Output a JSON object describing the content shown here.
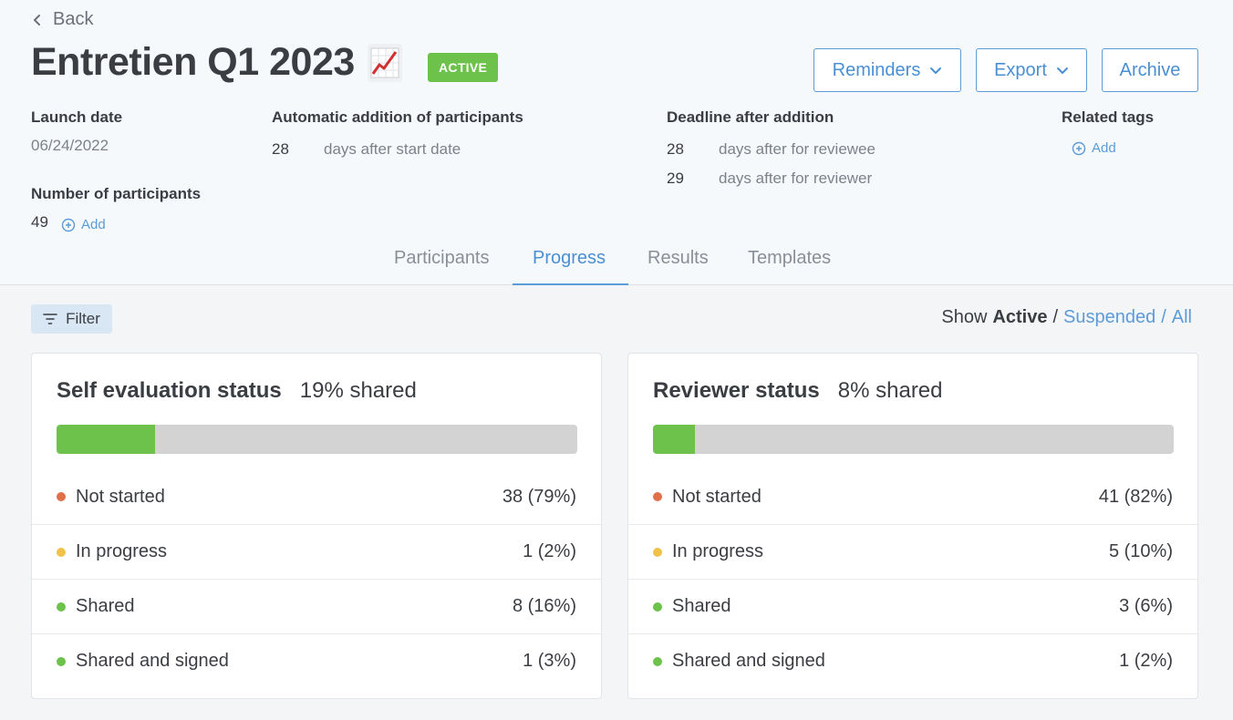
{
  "nav": {
    "back_label": "Back"
  },
  "campaign": {
    "title": "Entretien Q1 2023",
    "title_icon": "chart-increasing-icon",
    "status_badge": "ACTIVE"
  },
  "actions": {
    "reminders": "Reminders",
    "export": "Export",
    "archive": "Archive"
  },
  "meta": {
    "launch_date_label": "Launch date",
    "launch_date": "06/24/2022",
    "participants_label": "Number of participants",
    "participants_count": "49",
    "add_label": "Add",
    "auto_addition_label": "Automatic addition of participants",
    "auto_addition_days": "28",
    "auto_addition_text": "days after start date",
    "deadline_label": "Deadline after addition",
    "deadline_reviewee_days": "28",
    "deadline_reviewee_text": "days after for reviewee",
    "deadline_reviewer_days": "29",
    "deadline_reviewer_text": "days after for reviewer",
    "tags_label": "Related tags"
  },
  "tabs": [
    {
      "label": "Participants",
      "active": false
    },
    {
      "label": "Progress",
      "active": true
    },
    {
      "label": "Results",
      "active": false
    },
    {
      "label": "Templates",
      "active": false
    }
  ],
  "toolbar": {
    "filter_label": "Filter",
    "show_label": "Show",
    "show_active": "Active",
    "show_suspended": "Suspended",
    "show_all": "All",
    "separator": "/"
  },
  "colors": {
    "accent": "#5b9bd8",
    "success": "#6cc24a",
    "not_started": "#e0704a",
    "in_progress": "#f0c24a",
    "shared": "#6cc24a"
  },
  "cards": [
    {
      "title": "Self evaluation status",
      "shared_text": "19% shared",
      "progress": 0.19,
      "rows": [
        {
          "label": "Not started",
          "value": "38 (79%)",
          "status": "not_started"
        },
        {
          "label": "In progress",
          "value": "1 (2%)",
          "status": "in_progress"
        },
        {
          "label": "Shared",
          "value": "8 (16%)",
          "status": "shared"
        },
        {
          "label": "Shared and signed",
          "value": "1 (3%)",
          "status": "shared"
        }
      ]
    },
    {
      "title": "Reviewer status",
      "shared_text": "8% shared",
      "progress": 0.08,
      "rows": [
        {
          "label": "Not started",
          "value": "41 (82%)",
          "status": "not_started"
        },
        {
          "label": "In progress",
          "value": "5 (10%)",
          "status": "in_progress"
        },
        {
          "label": "Shared",
          "value": "3 (6%)",
          "status": "shared"
        },
        {
          "label": "Shared and signed",
          "value": "1 (2%)",
          "status": "shared"
        }
      ]
    }
  ]
}
